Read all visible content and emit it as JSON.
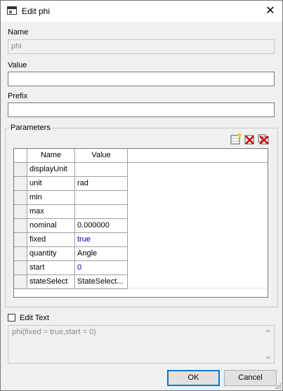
{
  "window": {
    "title": "Edit phi",
    "app_icon": "window-icon",
    "close_icon": "close-icon"
  },
  "name": {
    "label": "Name",
    "value": "phi"
  },
  "value": {
    "label": "Value",
    "value": ""
  },
  "prefix": {
    "label": "Prefix",
    "value": ""
  },
  "parameters": {
    "group_label": "Parameters",
    "toolbar": [
      {
        "name": "add-row-icon",
        "color": "#e8c000"
      },
      {
        "name": "delete-row-icon",
        "color": "#d00000"
      },
      {
        "name": "delete-all-rows-icon",
        "color": "#d00000"
      }
    ],
    "columns": [
      "Name",
      "Value"
    ],
    "rows": [
      {
        "name": "displayUnit",
        "value": "",
        "highlight": false
      },
      {
        "name": "unit",
        "value": "rad",
        "highlight": false
      },
      {
        "name": "min",
        "value": "",
        "highlight": false
      },
      {
        "name": "max",
        "value": "",
        "highlight": false
      },
      {
        "name": "nominal",
        "value": "0.000000",
        "highlight": false
      },
      {
        "name": "fixed",
        "value": "true",
        "highlight": true
      },
      {
        "name": "quantity",
        "value": "Angle",
        "highlight": false
      },
      {
        "name": "start",
        "value": "0",
        "highlight": true
      },
      {
        "name": "stateSelect",
        "value": "StateSelect...",
        "highlight": false
      }
    ]
  },
  "edit_text": {
    "label": "Edit Text",
    "checked": false,
    "content": "phi(fixed = true,start = 0)"
  },
  "buttons": {
    "ok": "OK",
    "cancel": "Cancel"
  },
  "colors": {
    "accent": "#0078d7",
    "value_highlight": "#0000c0"
  }
}
